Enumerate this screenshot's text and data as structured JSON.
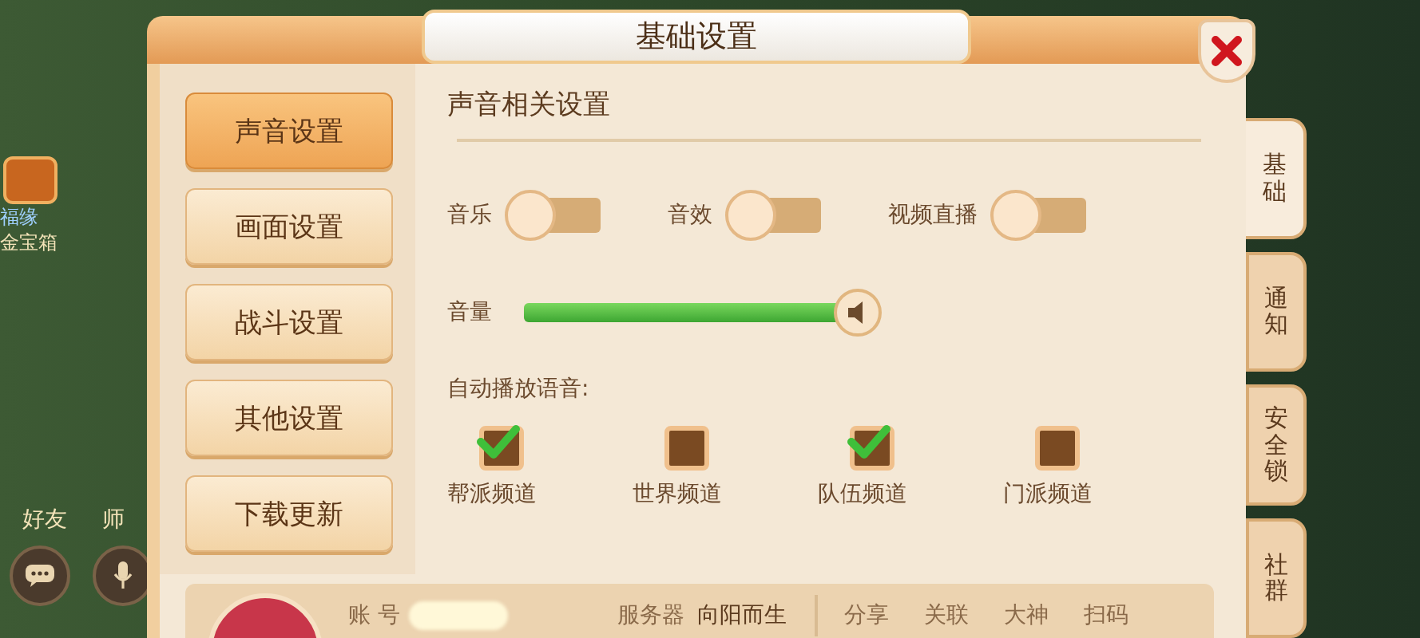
{
  "window": {
    "title": "基础设置"
  },
  "scene": {
    "labels": [
      "福缘",
      "金宝箱",
      "好友",
      "师"
    ]
  },
  "menu": [
    {
      "label": "声音设置",
      "selected": true
    },
    {
      "label": "画面设置",
      "selected": false
    },
    {
      "label": "战斗设置",
      "selected": false
    },
    {
      "label": "其他设置",
      "selected": false
    },
    {
      "label": "下载更新",
      "selected": false
    }
  ],
  "section_title": "声音相关设置",
  "toggles": [
    {
      "label": "音乐",
      "on": false
    },
    {
      "label": "音效",
      "on": false
    },
    {
      "label": "视频直播",
      "on": false
    }
  ],
  "volume": {
    "label": "音量",
    "level": 0.95
  },
  "auto_play": {
    "label": "自动播放语音:",
    "channels": [
      {
        "label": "帮派频道",
        "checked": true
      },
      {
        "label": "世界频道",
        "checked": false
      },
      {
        "label": "队伍频道",
        "checked": true
      },
      {
        "label": "门派频道",
        "checked": false
      }
    ]
  },
  "side_tabs": [
    {
      "label": "基础",
      "selected": true
    },
    {
      "label": "通知",
      "selected": false
    },
    {
      "label": "安全锁",
      "selected": false
    },
    {
      "label": "社群",
      "selected": false
    }
  ],
  "account": {
    "account_label": "账 号",
    "server_label": "服务器",
    "server": "向阳而生",
    "links": [
      "分享",
      "关联",
      "大神",
      "扫码"
    ]
  }
}
